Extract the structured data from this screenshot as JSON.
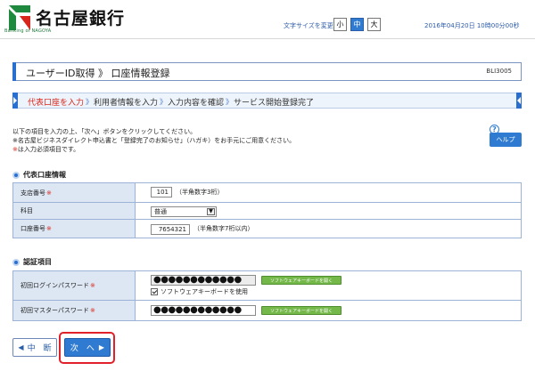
{
  "header": {
    "bank_name": "名古屋銀行",
    "logo_sub": "Banking of NAGOYA",
    "font_size_label": "文字サイズを変更",
    "font_sizes": [
      "小",
      "中",
      "大"
    ],
    "datetime": "2016年04月20日 10時00分00秒",
    "accent_color": "#2a6fcf"
  },
  "title": {
    "text": "ユーザーID取得 》 口座情報登録",
    "screen_id": "BLI3005"
  },
  "steps": [
    {
      "label": "代表口座を入力",
      "current": true
    },
    {
      "label": "利用者情報を入力",
      "current": false
    },
    {
      "label": "入力内容を確認",
      "current": false
    },
    {
      "label": "サービス開始登録完了",
      "current": false
    }
  ],
  "step_separator": "》",
  "instructions": {
    "line1": "以下の項目を入力の上、「次へ」ボタンをクリックしてください。",
    "line2": "※名古屋ビジネスダイレクト申込書と「登録完了のお知らせ」（ハガキ）をお手元にご用意ください。",
    "line3_mark": "※",
    "line3_rest": "は入力必須項目です。"
  },
  "help": {
    "icon": "?",
    "label": "ヘルプ"
  },
  "account_section": {
    "title": "代表口座情報",
    "branch_label": "支店番号",
    "branch_value": "101",
    "branch_hint": "（半角数字3桁）",
    "subject_label": "科目",
    "subject_value": "普通",
    "account_label": "口座番号",
    "account_value": "7654321",
    "account_hint": "（半角数字7桁以内）",
    "required_mark": "※"
  },
  "auth_section": {
    "title": "認証項目",
    "login_pw_label": "初回ログインパスワード",
    "login_pw_value": "●●●●●●●●●●●●",
    "keyboard_btn": "ソフトウェアキーボードを開く",
    "software_kb_checkbox": "ソフトウェアキーボードを使用",
    "master_pw_label": "初回マスターパスワード",
    "master_pw_value": "●●●●●●●●●●●●",
    "required_mark": "※"
  },
  "buttons": {
    "back": "中　断",
    "next": "次　へ"
  }
}
